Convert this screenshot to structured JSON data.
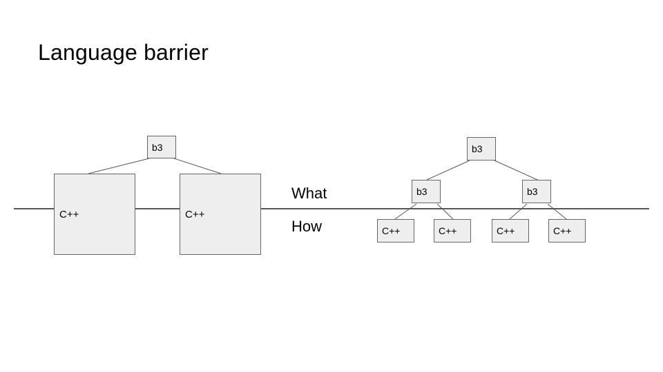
{
  "title": "Language barrier",
  "labels": {
    "what": "What",
    "how": "How"
  },
  "left_diagram": {
    "root": "b3",
    "children": [
      "C++",
      "C++"
    ]
  },
  "right_diagram": {
    "root": "b3",
    "mid": [
      "b3",
      "b3"
    ],
    "leaves": [
      "C++",
      "C++",
      "C++",
      "C++"
    ]
  }
}
